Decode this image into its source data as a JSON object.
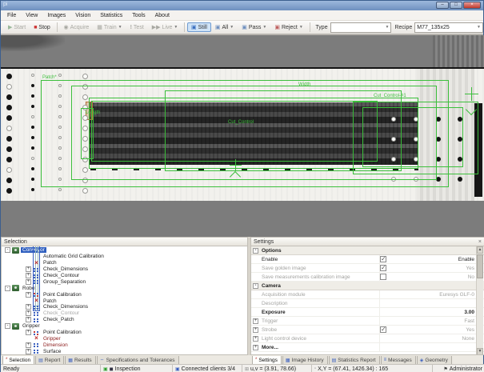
{
  "window": {
    "title": "pi",
    "controls": {
      "minimize": "–",
      "maximize": "□",
      "close": "×"
    }
  },
  "menu": {
    "items": [
      "File",
      "View",
      "Images",
      "Vision",
      "Statistics",
      "Tools",
      "About"
    ]
  },
  "toolbar": {
    "start": "Start",
    "stop": "Stop",
    "acquire": "Acquire",
    "train": "Train",
    "test": "Test",
    "live": "Live",
    "still": "Still",
    "all": "All",
    "pass": "Pass",
    "reject": "Reject",
    "type_label": "Type",
    "type_value": "",
    "recipe_label": "Recipe",
    "recipe_value": "M77_135x25"
  },
  "image_view": {
    "overlay_color": "#3cbf3c",
    "labels": {
      "patch": "Patch*",
      "width": "Width",
      "cut_control_1": "Cut_Control-#1",
      "length": "Length",
      "cut_control": "Cut_Control"
    }
  },
  "selection_panel": {
    "title": "Selection",
    "tree": [
      {
        "label": "Conveyor",
        "level": 0,
        "expander": "-",
        "icon": "camera",
        "selected": true
      },
      {
        "label": "Automatic Grid Calibration",
        "level": 1,
        "expander": "",
        "icon": "grid"
      },
      {
        "label": "Patch",
        "level": 1,
        "expander": "",
        "icon": "patch"
      },
      {
        "label": "Check_Dimensions",
        "level": 1,
        "expander": "+",
        "icon": "dots"
      },
      {
        "label": "Check_Contour",
        "level": 1,
        "expander": "+",
        "icon": "dots"
      },
      {
        "label": "Group_Separation",
        "level": 1,
        "expander": "+",
        "icon": "dots"
      },
      {
        "label": "Robot",
        "level": 0,
        "expander": "-",
        "icon": "camera"
      },
      {
        "label": "Point Calibration",
        "level": 1,
        "expander": "+",
        "icon": "points"
      },
      {
        "label": "Patch",
        "level": 1,
        "expander": "",
        "icon": "patch"
      },
      {
        "label": "Check_Dimensions",
        "level": 1,
        "expander": "+",
        "icon": "dots"
      },
      {
        "label": "Check_Contour",
        "level": 1,
        "expander": "+",
        "icon": "dots",
        "muted": true
      },
      {
        "label": "Check_Patch",
        "level": 1,
        "expander": "+",
        "icon": "dots"
      },
      {
        "label": "Gripper",
        "level": 0,
        "expander": "-",
        "icon": "camera"
      },
      {
        "label": "Point Calibration",
        "level": 1,
        "expander": "+",
        "icon": "points"
      },
      {
        "label": "Gripper",
        "level": 1,
        "expander": "",
        "icon": "patch",
        "red": true
      },
      {
        "label": "Dimension",
        "level": 1,
        "expander": "+",
        "icon": "dots",
        "red": true
      },
      {
        "label": "Surface",
        "level": 1,
        "expander": "+",
        "icon": "dots"
      }
    ],
    "tabs": [
      {
        "label": "Selection",
        "icon": "*",
        "active": true
      },
      {
        "label": "Report",
        "icon": "▤",
        "active": false
      },
      {
        "label": "Results",
        "icon": "▦",
        "active": false
      },
      {
        "label": "Specifications and Tolerances",
        "icon": "⇔",
        "active": false
      }
    ]
  },
  "settings_panel": {
    "title": "Settings",
    "close": "×",
    "groups": [
      {
        "name": "Options",
        "rows": [
          {
            "label": "Enable",
            "checkbox": "checked",
            "value": "Enable"
          },
          {
            "label": "Save golden image",
            "checkbox": "checked",
            "value": "Yes",
            "muted": true
          },
          {
            "label": "Save measurements calibration image",
            "checkbox": "unchecked",
            "value": "No",
            "muted": true
          }
        ]
      },
      {
        "name": "Camera",
        "rows": [
          {
            "label": "Acquisition module",
            "value": "Euresys GLF-0",
            "muted": true
          },
          {
            "label": "Description",
            "value": "",
            "muted": true
          },
          {
            "label": "Exposure",
            "value": "3.00",
            "bold": true
          },
          {
            "label": "Trigger",
            "value": "Fast",
            "muted": true,
            "expander": "+"
          },
          {
            "label": "Strobe",
            "checkbox": "checked",
            "value": "Yes",
            "muted": true,
            "expander": "+"
          },
          {
            "label": "Light control device",
            "value": "None",
            "muted": true,
            "expander": "+"
          },
          {
            "label": "More...",
            "value": "",
            "bold": true,
            "expander": "+"
          }
        ]
      }
    ],
    "tabs": [
      {
        "label": "Settings",
        "icon": "*",
        "active": true
      },
      {
        "label": "Image History",
        "icon": "▦",
        "active": false
      },
      {
        "label": "Statistics Report",
        "icon": "▤",
        "active": false
      },
      {
        "label": "Messages",
        "icon": "≡",
        "active": false
      },
      {
        "label": "Geometry",
        "icon": "◈",
        "active": false
      }
    ]
  },
  "status_bar": {
    "ready": "Ready",
    "inspection": "Inspection",
    "connected": "Connected clients 3/4",
    "uv": "u,v = (3.91, 78.66)",
    "xy": "X,Y = (67.41, 1426.34) : 165",
    "user": "Administrator"
  },
  "colors": {
    "overlay_green": "#3cbf3c",
    "selection_blue": "#2f5fbf",
    "stop_red": "#cc3333",
    "pressed_button_bg": "#cfe3f7"
  }
}
